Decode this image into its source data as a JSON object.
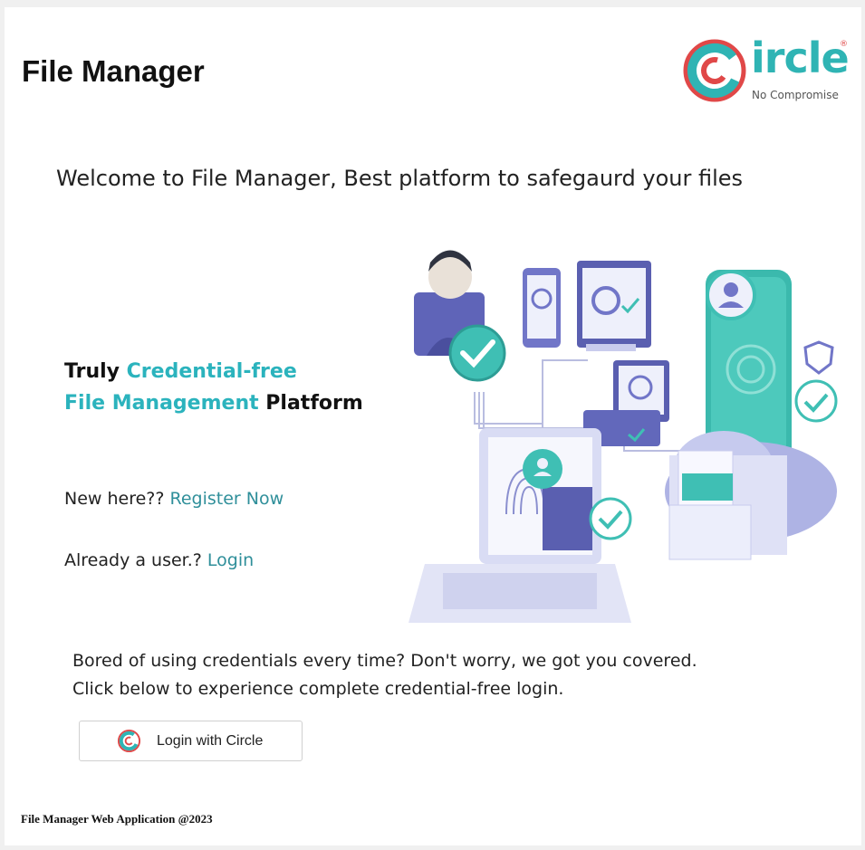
{
  "header": {
    "title": "File Manager",
    "logo": {
      "word": "ircle",
      "registered": "®",
      "tagline": "No Compromise"
    }
  },
  "main": {
    "welcome": "Welcome to File Manager, Best platform to safegaurd your files",
    "tagline": {
      "line1_dark": "Truly ",
      "line1_teal": "Credential-free",
      "line2_teal": "File Management",
      "line2_dark": " Platform"
    },
    "register": {
      "prefix": "New here?? ",
      "link": "Register Now"
    },
    "login": {
      "prefix": "Already a user.? ",
      "link": "Login"
    },
    "bored": {
      "line1": "Bored of using credentials every time? Don't worry, we got you covered.",
      "line2": "Click below to experience complete credential-free login."
    },
    "circle_button": {
      "label": "Login with Circle",
      "icon": "circle-logo-icon"
    }
  },
  "footer": {
    "text": "File Manager Web Application @2023"
  },
  "colors": {
    "teal": "#2bb3bd",
    "link": "#2f8f9a",
    "logo_red": "#e04848",
    "background": "#f0f0f0"
  }
}
